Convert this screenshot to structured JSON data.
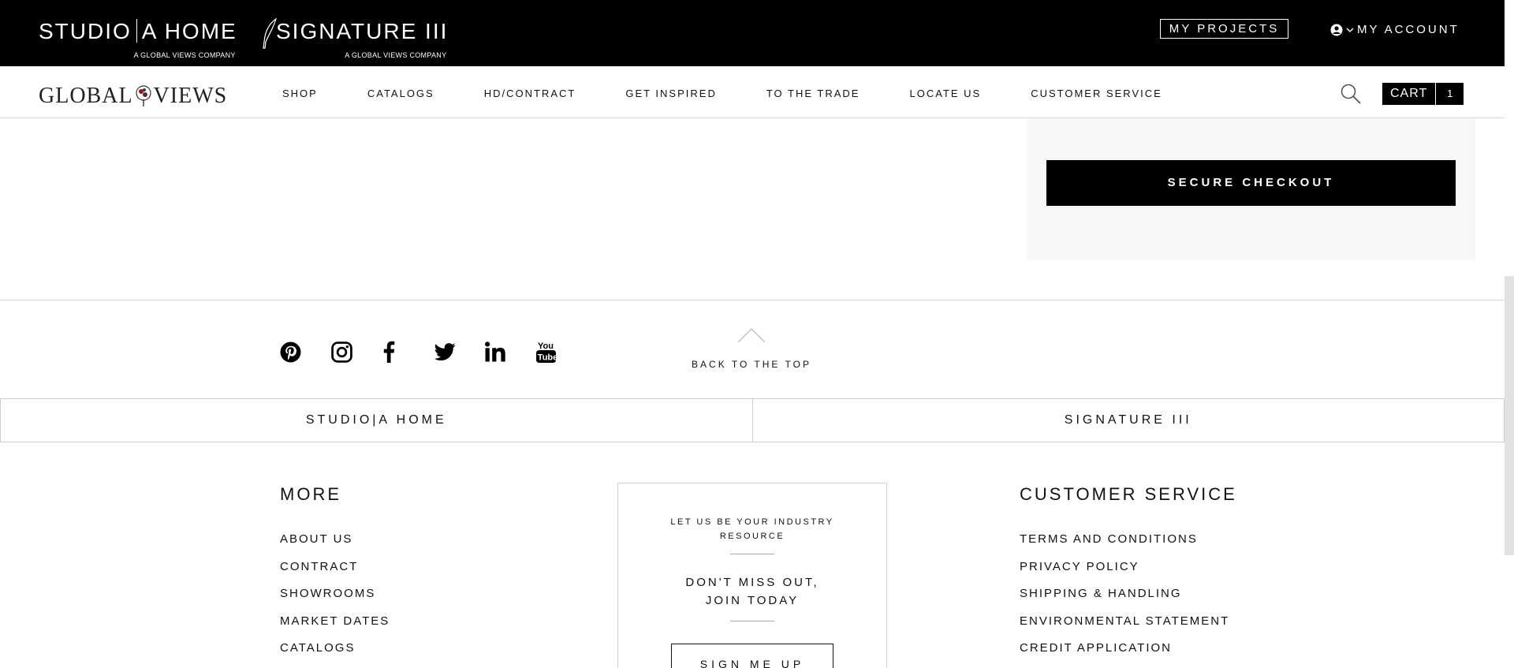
{
  "topbar": {
    "studio": {
      "left": "STUDIO",
      "right": "A   HOME",
      "sub": "A GLOBAL VIEWS COMPANY"
    },
    "signature": {
      "name": "SIGNATURE III",
      "sub": "A GLOBAL VIEWS COMPANY"
    },
    "my_projects": "MY PROJECTS",
    "my_account": "MY ACCOUNT"
  },
  "navbar": {
    "logo": {
      "left": "GLOBAL",
      "right": "VIEWS"
    },
    "items": [
      "SHOP",
      "CATALOGS",
      "HD/CONTRACT",
      "GET INSPIRED",
      "TO THE TRADE",
      "LOCATE US",
      "CUSTOMER SERVICE"
    ],
    "cart_label": "CART",
    "cart_count": "1"
  },
  "checkout": {
    "button": "SECURE CHECKOUT"
  },
  "footer": {
    "social_icons": [
      "pinterest-icon",
      "instagram-icon",
      "facebook-icon",
      "twitter-icon",
      "linkedin-icon",
      "youtube-icon"
    ],
    "back_to_top": "BACK TO THE TOP",
    "brand_links": [
      "STUDIO|A HOME",
      "SIGNATURE III"
    ],
    "more": {
      "title": "MORE",
      "links": [
        "ABOUT US",
        "CONTRACT",
        "SHOWROOMS",
        "MARKET DATES",
        "CATALOGS"
      ]
    },
    "signup": {
      "resource": "LET US BE YOUR INDUSTRY RESOURCE",
      "headline_1": "DON'T MISS OUT,",
      "headline_2": "JOIN TODAY",
      "button": "SIGN ME UP"
    },
    "customer_service": {
      "title": "CUSTOMER SERVICE",
      "links": [
        "TERMS AND CONDITIONS",
        "PRIVACY POLICY",
        "SHIPPING & HANDLING",
        "ENVIRONMENTAL STATEMENT",
        "CREDIT APPLICATION"
      ]
    }
  },
  "colors": {
    "topbar": "#000000",
    "panel": "#f8f8f8",
    "accent": "#000000"
  }
}
